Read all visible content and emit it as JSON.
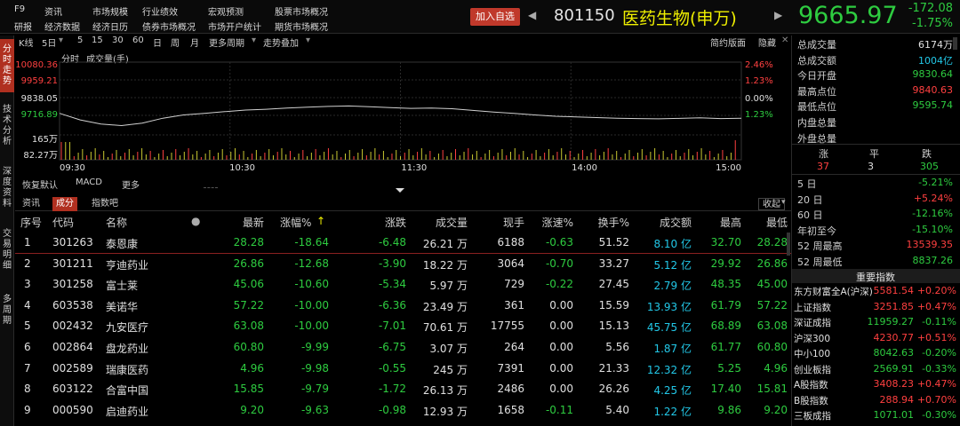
{
  "topbar": {
    "f9": "F9",
    "menus_row1": [
      "资讯",
      "市场规模",
      "行业绩效",
      "宏观预测",
      "股票市场概况"
    ],
    "menus_row2": [
      "研报",
      "经济数据",
      "经济日历",
      "债券市场概况",
      "市场开户统计",
      "期货市场概况"
    ],
    "add_button": "加入自选",
    "code": "801150",
    "name": "医药生物(申万)",
    "price": "9665.97",
    "change": "-172.08",
    "change_pct": "-1.75%"
  },
  "left_tabs": [
    "分时走势",
    "技术分析",
    "深度资料",
    "交易明细",
    "多周期"
  ],
  "chart_toolbar": {
    "items": [
      "K线",
      "5日",
      "5",
      "15",
      "30",
      "60",
      "日",
      "周",
      "月",
      "更多周期",
      "走势叠加"
    ],
    "right": [
      "简约版面",
      "隐藏"
    ],
    "sub": [
      "分时",
      "成交量(手)"
    ]
  },
  "chart_data": {
    "type": "line",
    "title": "",
    "y_left_ticks": [
      "10080.36",
      "9959.21",
      "9838.05",
      "9716.89"
    ],
    "y_right_ticks": [
      "2.46%",
      "1.23%",
      "0.00%",
      "1.23%"
    ],
    "volume_ticks": [
      "165万",
      "82.27万"
    ],
    "x_ticks": [
      "09:30",
      "10:30",
      "11:30",
      "14:00",
      "15:00"
    ],
    "ylim": [
      9716.89,
      10080.36
    ],
    "baseline": 9838.05,
    "price_series": [
      9800,
      9760,
      9735,
      9725,
      9740,
      9770,
      9790,
      9800,
      9810,
      9820,
      9825,
      9832,
      9838,
      9842,
      9845,
      9840,
      9835,
      9830,
      9832,
      9828,
      9818,
      9808,
      9800,
      9790,
      9782,
      9778,
      9774,
      9770,
      9768,
      9766,
      9769,
      9772,
      9768,
      9770
    ]
  },
  "bottom_tabs": [
    "恢复默认",
    "MACD",
    "更多"
  ],
  "table_tabs": [
    "资讯",
    "成分",
    "指数吧"
  ],
  "collapse": "收起",
  "table": {
    "headers": [
      "序号",
      "代码",
      "名称",
      "最新",
      "涨幅%",
      "涨跌",
      "成交量",
      "现手",
      "涨速%",
      "换手%",
      "成交额",
      "最高",
      "最低"
    ],
    "rows": [
      [
        "1",
        "301263",
        "泰恩康",
        "28.28",
        "-18.64",
        "-6.48",
        "26.21 万",
        "6188",
        "-0.63",
        "51.52",
        "8.10 亿",
        "32.70",
        "28.28"
      ],
      [
        "2",
        "301211",
        "亨迪药业",
        "26.86",
        "-12.68",
        "-3.90",
        "18.22 万",
        "3064",
        "-0.70",
        "33.27",
        "5.12 亿",
        "29.92",
        "26.86"
      ],
      [
        "3",
        "301258",
        "富士莱",
        "45.06",
        "-10.60",
        "-5.34",
        "5.97 万",
        "729",
        "-0.22",
        "27.45",
        "2.79 亿",
        "48.35",
        "45.00"
      ],
      [
        "4",
        "603538",
        "美诺华",
        "57.22",
        "-10.00",
        "-6.36",
        "23.49 万",
        "361",
        "0.00",
        "15.59",
        "13.93 亿",
        "61.79",
        "57.22"
      ],
      [
        "5",
        "002432",
        "九安医疗",
        "63.08",
        "-10.00",
        "-7.01",
        "70.61 万",
        "17755",
        "0.00",
        "15.13",
        "45.75 亿",
        "68.89",
        "63.08"
      ],
      [
        "6",
        "002864",
        "盘龙药业",
        "60.80",
        "-9.99",
        "-6.75",
        "3.07 万",
        "264",
        "0.00",
        "5.56",
        "1.87 亿",
        "61.77",
        "60.80"
      ],
      [
        "7",
        "002589",
        "瑞康医药",
        "4.96",
        "-9.98",
        "-0.55",
        "245 万",
        "7391",
        "0.00",
        "21.33",
        "12.32 亿",
        "5.25",
        "4.96"
      ],
      [
        "8",
        "603122",
        "合富中国",
        "15.85",
        "-9.79",
        "-1.72",
        "26.13 万",
        "2486",
        "0.00",
        "26.26",
        "4.25 亿",
        "17.40",
        "15.81"
      ],
      [
        "9",
        "000590",
        "启迪药业",
        "9.20",
        "-9.63",
        "-0.98",
        "12.93 万",
        "1658",
        "-0.11",
        "5.40",
        "1.22 亿",
        "9.86",
        "9.20"
      ]
    ]
  },
  "right_panel": {
    "stats": [
      {
        "label": "总成交量",
        "value": "6174万",
        "color": "#e0e0e0"
      },
      {
        "label": "总成交额",
        "value": "1004亿",
        "color": "#22c8e8"
      },
      {
        "label": "今日开盘",
        "value": "9830.64",
        "color": "#2ecc40"
      },
      {
        "label": "最高点位",
        "value": "9840.63",
        "color": "#ff4040"
      },
      {
        "label": "最低点位",
        "value": "9595.74",
        "color": "#2ecc40"
      },
      {
        "label": "内盘总量",
        "value": "",
        "color": "#e0e0e0"
      },
      {
        "label": "外盘总量",
        "value": "",
        "color": "#e0e0e0"
      }
    ],
    "updown_labels": [
      "涨",
      "平",
      "跌"
    ],
    "updown_values": [
      "37",
      "3",
      "305"
    ],
    "periods": [
      {
        "label": "5 日",
        "value": "-5.21%",
        "color": "#2ecc40"
      },
      {
        "label": "20 日",
        "value": "+5.24%",
        "color": "#ff4040"
      },
      {
        "label": "60 日",
        "value": "-12.16%",
        "color": "#2ecc40"
      },
      {
        "label": "年初至今",
        "value": "-15.10%",
        "color": "#2ecc40"
      },
      {
        "label": "52 周最高",
        "value": "13539.35",
        "color": "#ff4040"
      },
      {
        "label": "52 周最低",
        "value": "8837.26",
        "color": "#2ecc40"
      }
    ],
    "index_title": "重要指数",
    "indices": [
      {
        "name": "东方财富全A(沪深)",
        "value": "5581.54",
        "pct": "+0.20%",
        "color": "#ff4040"
      },
      {
        "name": "上证指数",
        "value": "3251.85",
        "pct": "+0.47%",
        "color": "#ff4040"
      },
      {
        "name": "深证成指",
        "value": "11959.27",
        "pct": "-0.11%",
        "color": "#2ecc40"
      },
      {
        "name": "沪深300",
        "value": "4230.77",
        "pct": "+0.51%",
        "color": "#ff4040"
      },
      {
        "name": "中小100",
        "value": "8042.63",
        "pct": "-0.20%",
        "color": "#2ecc40"
      },
      {
        "name": "创业板指",
        "value": "2569.91",
        "pct": "-0.33%",
        "color": "#2ecc40"
      },
      {
        "name": "A股指数",
        "value": "3408.23",
        "pct": "+0.47%",
        "color": "#ff4040"
      },
      {
        "name": "B股指数",
        "value": "288.94",
        "pct": "+0.70%",
        "color": "#ff4040"
      },
      {
        "name": "三板成指",
        "value": "1071.01",
        "pct": "-0.30%",
        "color": "#2ecc40"
      }
    ]
  }
}
